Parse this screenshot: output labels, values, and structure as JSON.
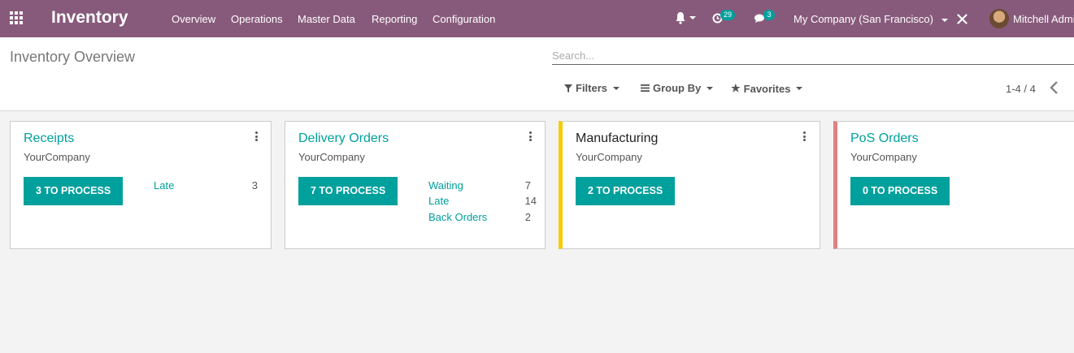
{
  "navbar": {
    "app_title": "Inventory",
    "menu": [
      "Overview",
      "Operations",
      "Master Data",
      "Reporting",
      "Configuration"
    ],
    "activity_count": "29",
    "messages_count": "3",
    "company": "My Company (San Francisco)",
    "user": "Mitchell Admin",
    "icons": [
      "apps-grid-icon",
      "bell-icon",
      "clock-icon",
      "chat-icon",
      "debug-tools-icon"
    ],
    "bg_color": "#875a7b"
  },
  "control_panel": {
    "breadcrumb": "Inventory Overview",
    "search_placeholder": "Search...",
    "filters_label": "Filters",
    "groupby_label": "Group By",
    "favorites_label": "Favorites",
    "pager": "1-4 / 4"
  },
  "cards": [
    {
      "title": "Receipts",
      "company": "YourCompany",
      "button": "3 TO PROCESS",
      "stats": [
        {
          "label": "Late",
          "value": "3"
        }
      ]
    },
    {
      "title": "Delivery Orders",
      "company": "YourCompany",
      "button": "7 TO PROCESS",
      "stats": [
        {
          "label": "Waiting",
          "value": "7"
        },
        {
          "label": "Late",
          "value": "14"
        },
        {
          "label": "Back Orders",
          "value": "2"
        }
      ]
    },
    {
      "title": "Manufacturing",
      "company": "YourCompany",
      "button": "2 TO PROCESS",
      "accent": "#f4cc00",
      "stats": []
    },
    {
      "title": "PoS Orders",
      "company": "YourCompany",
      "button": "0 TO PROCESS",
      "accent": "#e08080",
      "stats": []
    }
  ],
  "colors": {
    "primary": "#00a09d",
    "brand": "#875a7b"
  }
}
